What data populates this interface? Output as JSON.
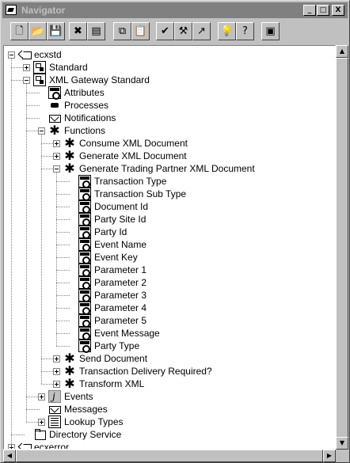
{
  "window": {
    "title": "Navigator",
    "controls": {
      "minimize": "_",
      "maximize": "□",
      "close": "X"
    }
  },
  "toolbar": {
    "buttons": [
      {
        "name": "new-icon",
        "glyph": "🗋"
      },
      {
        "name": "open-icon",
        "glyph": "📂"
      },
      {
        "name": "save-icon",
        "glyph": "💾"
      },
      {
        "name": "delete-icon",
        "glyph": "✖"
      },
      {
        "name": "properties-icon",
        "glyph": "▤"
      },
      {
        "name": "copy-icon",
        "glyph": "⧉"
      },
      {
        "name": "paste-icon",
        "glyph": "📋"
      },
      {
        "name": "check-icon",
        "glyph": "✔"
      },
      {
        "name": "hammer-icon",
        "glyph": "⚒"
      },
      {
        "name": "wand-icon",
        "glyph": "↗"
      },
      {
        "name": "lightbulb-icon",
        "glyph": "💡"
      },
      {
        "name": "help-icon",
        "glyph": "?"
      },
      {
        "name": "stop-icon",
        "glyph": "▣"
      }
    ]
  },
  "tree": {
    "nodes": [
      {
        "label": "ecxstd",
        "icon": "tag",
        "level": 0,
        "expander": "minus"
      },
      {
        "label": "Standard",
        "icon": "item-type",
        "level": 1,
        "expander": "plus"
      },
      {
        "label": "XML Gateway Standard",
        "icon": "item-type",
        "level": 1,
        "expander": "minus"
      },
      {
        "label": "Attributes",
        "icon": "attr",
        "level": 2,
        "expander": "none"
      },
      {
        "label": "Processes",
        "icon": "process",
        "level": 2,
        "expander": "none"
      },
      {
        "label": "Notifications",
        "icon": "envelope",
        "level": 2,
        "expander": "none"
      },
      {
        "label": "Functions",
        "icon": "gear",
        "level": 2,
        "expander": "minus"
      },
      {
        "label": "Consume XML Document",
        "icon": "gear",
        "level": 3,
        "expander": "plus"
      },
      {
        "label": "Generate  XML Document",
        "icon": "gear",
        "level": 3,
        "expander": "plus"
      },
      {
        "label": "Generate Trading Partner XML Document",
        "icon": "gear",
        "level": 3,
        "expander": "minus"
      },
      {
        "label": "Transaction Type",
        "icon": "attr",
        "level": 4,
        "expander": "none"
      },
      {
        "label": "Transaction Sub Type",
        "icon": "attr",
        "level": 4,
        "expander": "none"
      },
      {
        "label": "Document Id",
        "icon": "attr",
        "level": 4,
        "expander": "none"
      },
      {
        "label": "Party Site Id",
        "icon": "attr",
        "level": 4,
        "expander": "none"
      },
      {
        "label": "Party Id",
        "icon": "attr",
        "level": 4,
        "expander": "none"
      },
      {
        "label": "Event Name",
        "icon": "attr",
        "level": 4,
        "expander": "none"
      },
      {
        "label": "Event Key",
        "icon": "attr",
        "level": 4,
        "expander": "none"
      },
      {
        "label": "Parameter 1",
        "icon": "attr",
        "level": 4,
        "expander": "none"
      },
      {
        "label": "Parameter 2",
        "icon": "attr",
        "level": 4,
        "expander": "none"
      },
      {
        "label": "Parameter 3",
        "icon": "attr",
        "level": 4,
        "expander": "none"
      },
      {
        "label": "Parameter 4",
        "icon": "attr",
        "level": 4,
        "expander": "none"
      },
      {
        "label": "Parameter 5",
        "icon": "attr",
        "level": 4,
        "expander": "none"
      },
      {
        "label": "Event Message",
        "icon": "attr",
        "level": 4,
        "expander": "none"
      },
      {
        "label": "Party Type",
        "icon": "attr",
        "level": 4,
        "expander": "none"
      },
      {
        "label": "Send Document",
        "icon": "gear",
        "level": 3,
        "expander": "plus"
      },
      {
        "label": "Transaction  Delivery Required?",
        "icon": "gear",
        "level": 3,
        "expander": "plus"
      },
      {
        "label": "Transform XML",
        "icon": "gear",
        "level": 3,
        "expander": "plus"
      },
      {
        "label": "Events",
        "icon": "event",
        "level": 2,
        "expander": "plus"
      },
      {
        "label": "Messages",
        "icon": "envelope",
        "level": 2,
        "expander": "none"
      },
      {
        "label": "Lookup Types",
        "icon": "lookup",
        "level": 2,
        "expander": "plus"
      },
      {
        "label": "Directory Service",
        "icon": "directory",
        "level": 1,
        "expander": "none"
      },
      {
        "label": "ecxerror",
        "icon": "tag",
        "level": 0,
        "expander": "plus"
      }
    ]
  },
  "scrollbars": {
    "up": "▲",
    "down": "▼",
    "left": "◀",
    "right": "▶"
  }
}
